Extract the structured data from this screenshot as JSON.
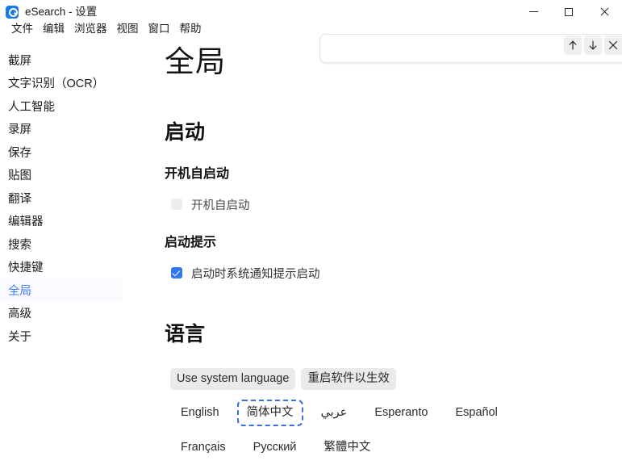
{
  "window": {
    "title": "eSearch - 设置",
    "icon": "search-app-icon",
    "controls": {
      "minimize": "minimize-icon",
      "maximize": "maximize-icon",
      "close": "close-icon"
    }
  },
  "menubar": {
    "items": [
      {
        "label": "文件"
      },
      {
        "label": "编辑"
      },
      {
        "label": "浏览器"
      },
      {
        "label": "视图"
      },
      {
        "label": "窗口"
      },
      {
        "label": "帮助"
      }
    ]
  },
  "findbar": {
    "value": "",
    "placeholder": "",
    "prev_icon": "arrow-up-icon",
    "next_icon": "arrow-down-icon",
    "close_icon": "close-icon"
  },
  "sidebar": {
    "items": [
      {
        "label": "截屏",
        "active": false
      },
      {
        "label": "文字识别（OCR）",
        "active": false
      },
      {
        "label": "人工智能",
        "active": false
      },
      {
        "label": "录屏",
        "active": false
      },
      {
        "label": "保存",
        "active": false
      },
      {
        "label": "贴图",
        "active": false
      },
      {
        "label": "翻译",
        "active": false
      },
      {
        "label": "编辑器",
        "active": false
      },
      {
        "label": "搜索",
        "active": false
      },
      {
        "label": "快捷键",
        "active": false
      },
      {
        "label": "全局",
        "active": true
      },
      {
        "label": "高级",
        "active": false
      },
      {
        "label": "关于",
        "active": false
      }
    ],
    "active_label": "全局"
  },
  "main": {
    "page_title": "全局",
    "startup": {
      "section_title": "启动",
      "autostart": {
        "sub_title": "开机自启动",
        "checkbox_label": "开机自启动",
        "checked": false
      },
      "notify": {
        "sub_title": "启动提示",
        "checkbox_label": "启动时系统通知提示启动",
        "checked": true
      }
    },
    "language": {
      "section_title": "语言",
      "use_system_label": "Use system language",
      "restart_hint_label": "重启软件以生效",
      "options": [
        {
          "label": "English",
          "focused": false,
          "rtl": false
        },
        {
          "label": "简体中文",
          "focused": true,
          "rtl": false
        },
        {
          "label": "عربي",
          "focused": false,
          "rtl": true
        },
        {
          "label": "Esperanto",
          "focused": false,
          "rtl": false
        },
        {
          "label": "Español",
          "focused": false,
          "rtl": false
        },
        {
          "label": "Français",
          "focused": false,
          "rtl": false
        },
        {
          "label": "Русский",
          "focused": false,
          "rtl": false
        },
        {
          "label": "繁體中文",
          "focused": false,
          "rtl": false
        }
      ],
      "selected": "简体中文"
    }
  },
  "colors": {
    "accent": "#3a7afe",
    "checkbox_on": "#2f77f0",
    "pill_bg": "#eaeaea",
    "focus_ring": "#3a6fe0",
    "text": "#1b1b1b",
    "background": "#ffffff"
  }
}
